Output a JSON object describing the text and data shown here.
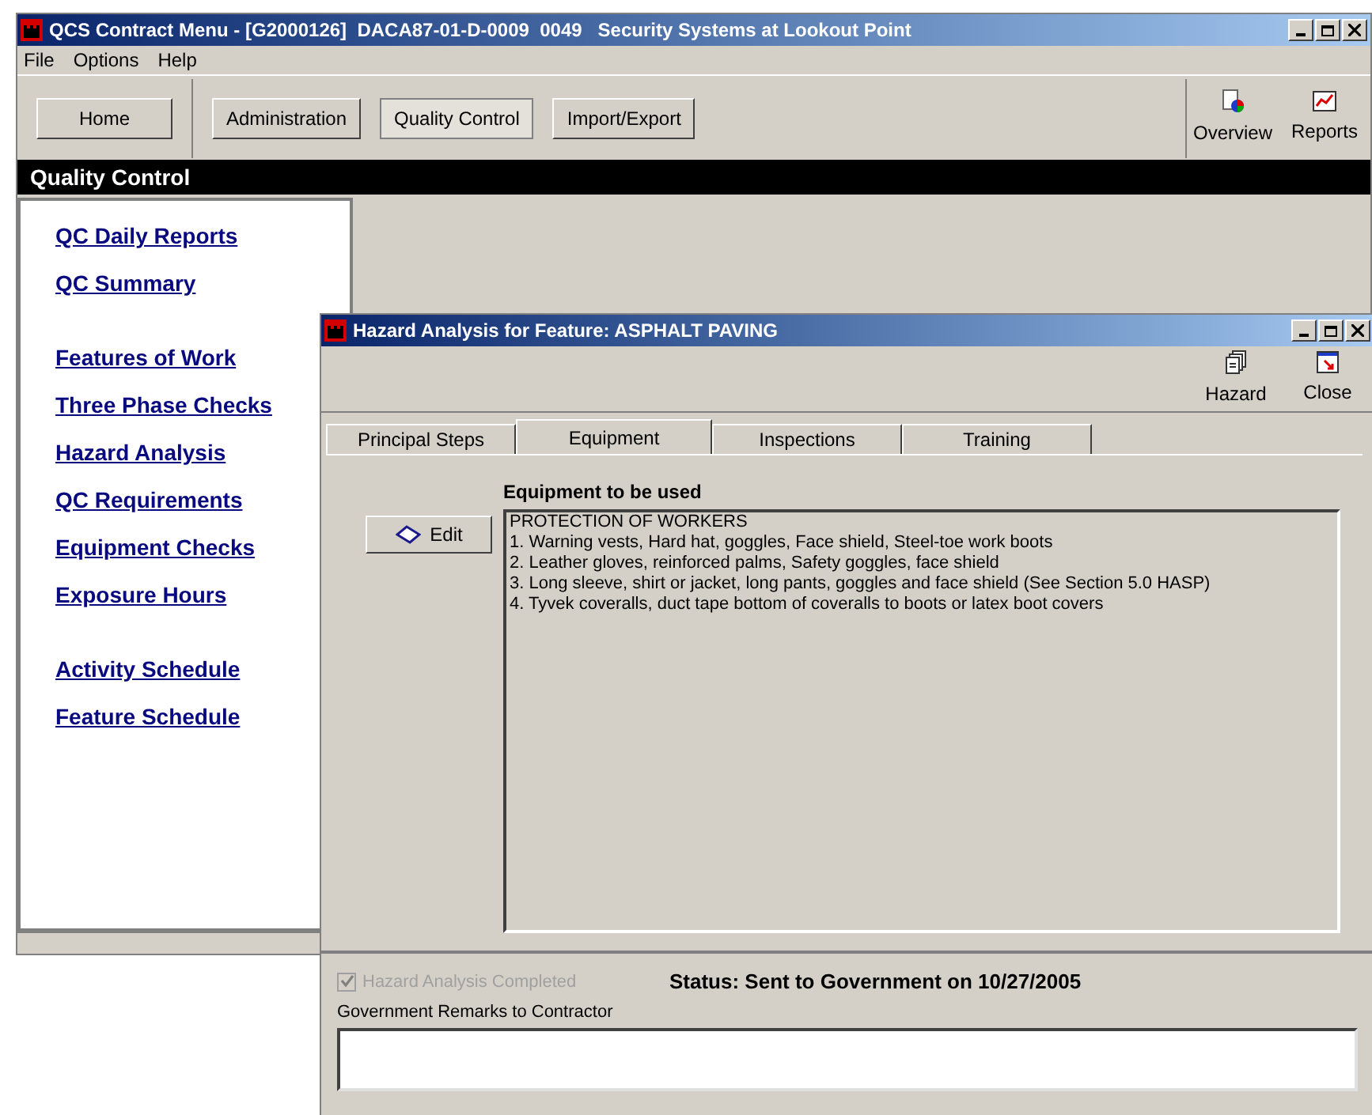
{
  "main_window": {
    "title": "QCS Contract Menu - [G2000126]  DACA87-01-D-0009  0049   Security Systems at Lookout Point"
  },
  "menu": [
    "File",
    "Options",
    "Help"
  ],
  "nav_buttons": [
    {
      "label": "Home",
      "selected": false
    },
    {
      "label": "Administration",
      "selected": false
    },
    {
      "label": "Quality Control",
      "selected": true
    },
    {
      "label": "Import/Export",
      "selected": false
    }
  ],
  "toolbar_right": [
    {
      "kind": "overview",
      "label": "Overview"
    },
    {
      "kind": "reports",
      "label": "Reports"
    }
  ],
  "section_title": "Quality Control",
  "sidebar": {
    "groups": [
      [
        "QC Daily Reports",
        "QC Summary"
      ],
      [
        "Features of Work",
        "Three Phase Checks",
        "Hazard Analysis",
        "QC Requirements",
        "Equipment Checks",
        "Exposure Hours"
      ],
      [
        "Activity Schedule",
        "Feature Schedule"
      ]
    ]
  },
  "dialog": {
    "title": "Hazard Analysis for Feature: ASPHALT PAVING",
    "toolbar": [
      {
        "kind": "hazard",
        "label": "Hazard"
      },
      {
        "kind": "close",
        "label": "Close"
      }
    ],
    "tabs": [
      {
        "label": "Principal Steps",
        "selected": false
      },
      {
        "label": "Equipment",
        "selected": true
      },
      {
        "label": "Inspections",
        "selected": false
      },
      {
        "label": "Training",
        "selected": false
      }
    ],
    "edit_button": "Edit",
    "equipment_label": "Equipment to be used",
    "equipment_lines": [
      "PROTECTION OF WORKERS",
      "1. Warning vests, Hard hat, goggles, Face shield, Steel-toe work boots",
      "2. Leather gloves, reinforced palms, Safety goggles, face shield",
      "3. Long sleeve, shirt or jacket, long pants, goggles and face shield (See Section 5.0 HASP)",
      "4. Tyvek coveralls, duct tape bottom of coveralls to boots or latex boot covers"
    ],
    "completed": {
      "label": "Hazard Analysis Completed",
      "checked": true,
      "disabled": true
    },
    "status": "Status: Sent to Government on 10/27/2005",
    "remarks_label": "Government Remarks to Contractor"
  }
}
